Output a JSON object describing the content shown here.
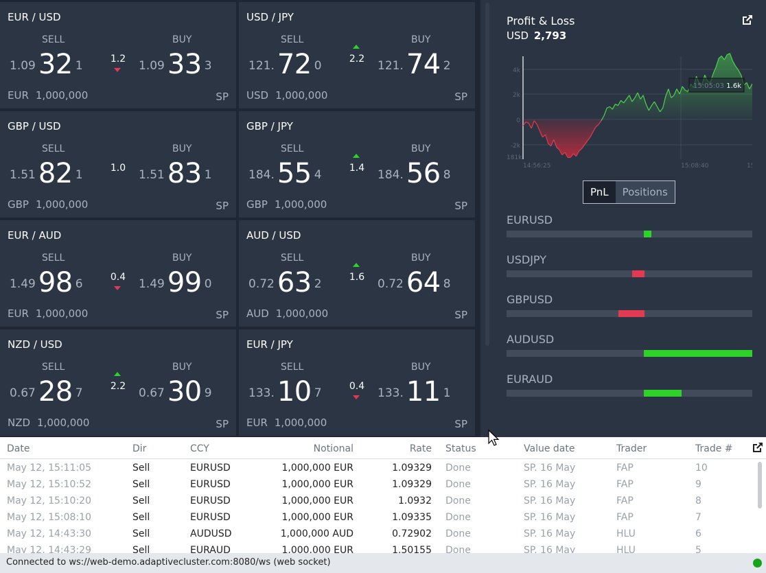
{
  "tile_labels": {
    "sell": "SELL",
    "buy": "BUY",
    "settlement": "SP"
  },
  "tiles": [
    {
      "pair": "EUR / USD",
      "sell": {
        "prefix": "1.09",
        "big": "32",
        "pip": "1"
      },
      "buy": {
        "prefix": "1.09",
        "big": "33",
        "pip": "3"
      },
      "spread": "1.2",
      "movement": "down",
      "notional_ccy": "EUR",
      "notional": "1,000,000"
    },
    {
      "pair": "USD / JPY",
      "sell": {
        "prefix": "121.",
        "big": "72",
        "pip": "0"
      },
      "buy": {
        "prefix": "121.",
        "big": "74",
        "pip": "2"
      },
      "spread": "2.2",
      "movement": "up",
      "notional_ccy": "USD",
      "notional": "1,000,000"
    },
    {
      "pair": "GBP / USD",
      "sell": {
        "prefix": "1.51",
        "big": "82",
        "pip": "1"
      },
      "buy": {
        "prefix": "1.51",
        "big": "83",
        "pip": "1"
      },
      "spread": "1.0",
      "movement": "none",
      "notional_ccy": "GBP",
      "notional": "1,000,000"
    },
    {
      "pair": "GBP / JPY",
      "sell": {
        "prefix": "184.",
        "big": "55",
        "pip": "4"
      },
      "buy": {
        "prefix": "184.",
        "big": "56",
        "pip": "8"
      },
      "spread": "1.4",
      "movement": "up",
      "notional_ccy": "GBP",
      "notional": "1,000,000"
    },
    {
      "pair": "EUR / AUD",
      "sell": {
        "prefix": "1.49",
        "big": "98",
        "pip": "6"
      },
      "buy": {
        "prefix": "1.49",
        "big": "99",
        "pip": "0"
      },
      "spread": "0.4",
      "movement": "down",
      "notional_ccy": "EUR",
      "notional": "1,000,000"
    },
    {
      "pair": "AUD / USD",
      "sell": {
        "prefix": "0.72",
        "big": "63",
        "pip": "2"
      },
      "buy": {
        "prefix": "0.72",
        "big": "64",
        "pip": "8"
      },
      "spread": "1.6",
      "movement": "up",
      "notional_ccy": "AUD",
      "notional": "1,000,000"
    },
    {
      "pair": "NZD / USD",
      "sell": {
        "prefix": "0.67",
        "big": "28",
        "pip": "7"
      },
      "buy": {
        "prefix": "0.67",
        "big": "30",
        "pip": "9"
      },
      "spread": "2.2",
      "movement": "up",
      "notional_ccy": "NZD",
      "notional": "1,000,000"
    },
    {
      "pair": "EUR / JPY",
      "sell": {
        "prefix": "133.",
        "big": "10",
        "pip": "7"
      },
      "buy": {
        "prefix": "133.",
        "big": "11",
        "pip": "1"
      },
      "spread": "0.4",
      "movement": "down",
      "notional_ccy": "EUR",
      "notional": "1,000,000"
    }
  ],
  "pnl": {
    "title": "Profit & Loss",
    "currency": "USD",
    "amount": "2,793",
    "chart": {
      "y_ticks": [
        "4k",
        "2k",
        "0",
        "-2k"
      ],
      "x_ticks": [
        "14:56:25",
        "15:08:40",
        "15:1"
      ],
      "partial_tick": "181k",
      "hover_time": "15:05:03",
      "hover_value": "1.6k",
      "line_color": "#4fd14a",
      "neg_color": "#e33a54"
    },
    "toggle": {
      "pnl": "PnL",
      "positions": "Positions"
    },
    "positions": [
      {
        "pair": "EURUSD",
        "start": 0.56,
        "end": 0.59,
        "color": "#2fd229"
      },
      {
        "pair": "USDJPY",
        "start": 0.51,
        "end": 0.56,
        "color": "#e33a54"
      },
      {
        "pair": "GBPUSD",
        "start": 0.455,
        "end": 0.56,
        "color": "#e33a54"
      },
      {
        "pair": "AUDUSD",
        "start": 0.56,
        "end": 1.0,
        "color": "#2fd229"
      },
      {
        "pair": "EURAUD",
        "start": 0.56,
        "end": 0.715,
        "color": "#2fd229"
      }
    ]
  },
  "blotter": {
    "headers": {
      "date": "Date",
      "dir": "Dir",
      "ccy": "CCY",
      "notional": "Notional",
      "rate": "Rate",
      "status": "Status",
      "value_date": "Value date",
      "trader": "Trader",
      "trade_no": "Trade #"
    },
    "rows": [
      {
        "date": "May 12, 15:11:05",
        "dir": "Sell",
        "ccy": "EURUSD",
        "notional": "1,000,000 EUR",
        "rate": "1.09329",
        "status": "Done",
        "value_date": "SP. 16 May",
        "trader": "FAP",
        "trade_no": "10"
      },
      {
        "date": "May 12, 15:10:52",
        "dir": "Sell",
        "ccy": "EURUSD",
        "notional": "1,000,000 EUR",
        "rate": "1.09329",
        "status": "Done",
        "value_date": "SP. 16 May",
        "trader": "FAP",
        "trade_no": "9"
      },
      {
        "date": "May 12, 15:10:20",
        "dir": "Sell",
        "ccy": "EURUSD",
        "notional": "1,000,000 EUR",
        "rate": "1.0932",
        "status": "Done",
        "value_date": "SP. 16 May",
        "trader": "FAP",
        "trade_no": "8"
      },
      {
        "date": "May 12, 15:08:10",
        "dir": "Sell",
        "ccy": "EURUSD",
        "notional": "1,000,000 EUR",
        "rate": "1.09335",
        "status": "Done",
        "value_date": "SP. 16 May",
        "trader": "FAP",
        "trade_no": "7"
      },
      {
        "date": "May 12, 14:43:30",
        "dir": "Sell",
        "ccy": "AUDUSD",
        "notional": "1,000,000 AUD",
        "rate": "0.72902",
        "status": "Done",
        "value_date": "SP. 16 May",
        "trader": "HLU",
        "trade_no": "6"
      },
      {
        "date": "May 12, 14:43:29",
        "dir": "Sell",
        "ccy": "EURAUD",
        "notional": "1,000,000 EUR",
        "rate": "1.50155",
        "status": "Done",
        "value_date": "SP. 16 May",
        "trader": "HLU",
        "trade_no": "5"
      }
    ]
  },
  "status_bar": {
    "text": "Connected to ws://web-demo.adaptivecluster.com:8080/ws (web socket)",
    "indicator_color": "#16a51a"
  },
  "icons": {
    "pnl_popout": "external-link-icon",
    "blotter_popout": "external-link-icon",
    "cursor": "mouse-cursor-icon"
  }
}
